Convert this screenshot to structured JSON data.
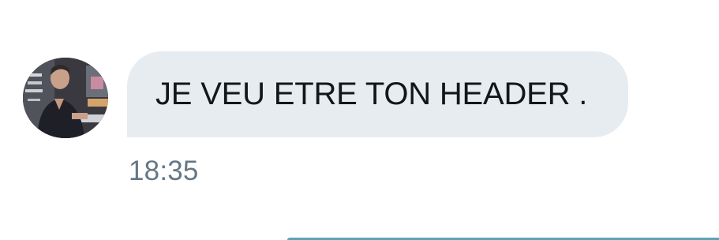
{
  "conversation": {
    "messages": [
      {
        "text": "JE VEU ETRE TON HEADER .",
        "time": "18:35"
      }
    ]
  },
  "colors": {
    "bubble_background": "#e6ecf0",
    "message_text": "#14171a",
    "timestamp_text": "#657786",
    "accent_line": "#5ba4b8"
  }
}
